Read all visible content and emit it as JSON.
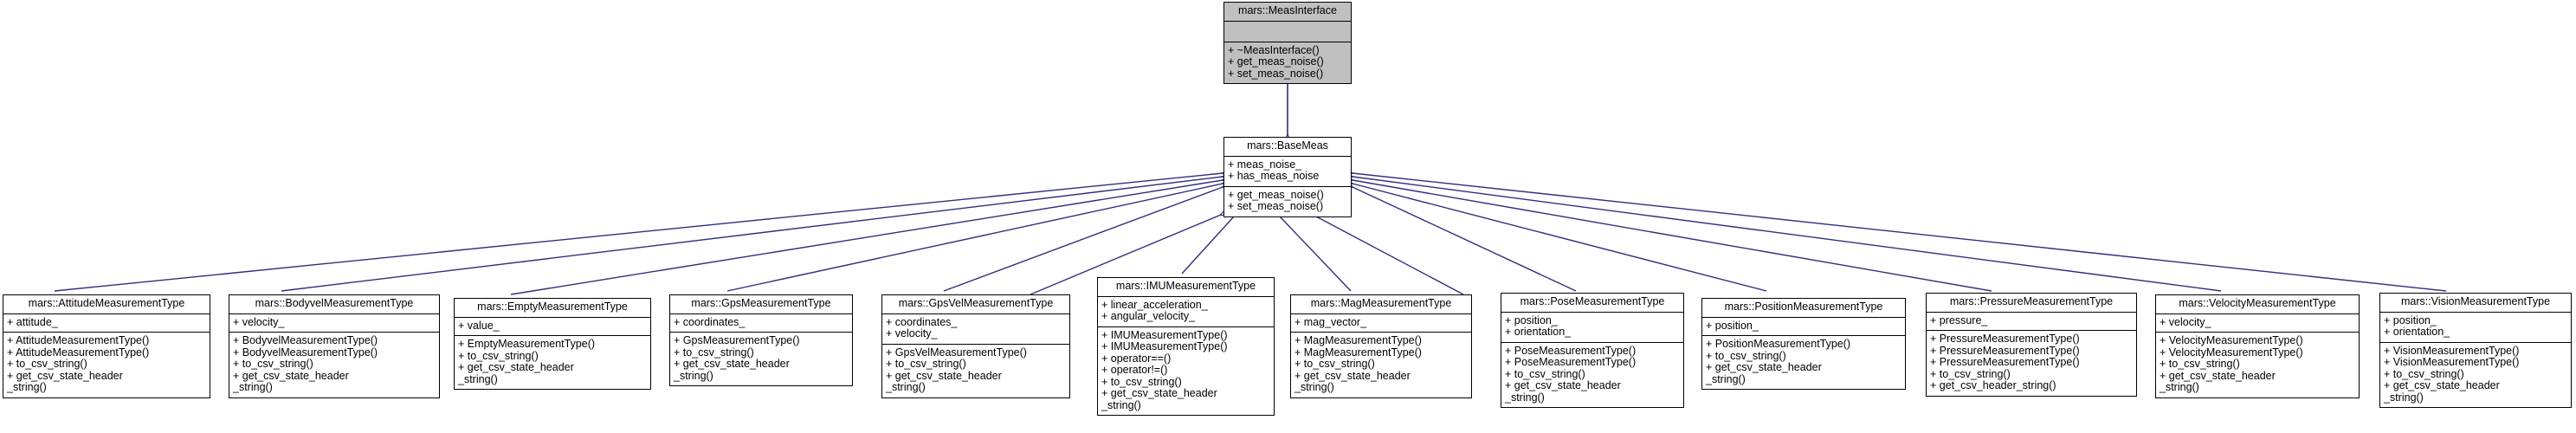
{
  "diagram": {
    "type": "uml-class-inheritance",
    "title": "mars::MeasInterface inheritance diagram",
    "namespace": "mars",
    "colors": {
      "interface_fill": "#c0c0c0",
      "class_fill": "#ffffff",
      "border": "#000000",
      "edge": "#2f2f7f",
      "text": "#000000"
    }
  },
  "classes": {
    "meas_interface": {
      "name": "mars::MeasInterface",
      "attributes": [],
      "operations": [
        "+ ~MeasInterface()",
        "+ get_meas_noise()",
        "+ set_meas_noise()"
      ]
    },
    "base_meas": {
      "name": "mars::BaseMeas",
      "attributes": [
        "+ meas_noise_",
        "+ has_meas_noise"
      ],
      "operations": [
        "+ get_meas_noise()",
        "+ set_meas_noise()"
      ]
    },
    "derived": [
      {
        "id": "attitude",
        "name": "mars::AttitudeMeasurementType",
        "attributes": [
          "+ attitude_"
        ],
        "operations": [
          "+ AttitudeMeasurementType()",
          "+ AttitudeMeasurementType()",
          "+ to_csv_string()",
          "+ get_csv_state_header",
          "_string()"
        ]
      },
      {
        "id": "bodyvel",
        "name": "mars::BodyvelMeasurementType",
        "attributes": [
          "+ velocity_"
        ],
        "operations": [
          "+ BodyvelMeasurementType()",
          "+ BodyvelMeasurementType()",
          "+ to_csv_string()",
          "+ get_csv_state_header",
          "_string()"
        ]
      },
      {
        "id": "empty",
        "name": "mars::EmptyMeasurementType",
        "attributes": [
          "+ value_"
        ],
        "operations": [
          "+ EmptyMeasurementType()",
          "+ to_csv_string()",
          "+ get_csv_state_header",
          "_string()"
        ]
      },
      {
        "id": "gps",
        "name": "mars::GpsMeasurementType",
        "attributes": [
          "+ coordinates_"
        ],
        "operations": [
          "+ GpsMeasurementType()",
          "+ to_csv_string()",
          "+ get_csv_state_header",
          "_string()"
        ]
      },
      {
        "id": "gpsvel",
        "name": "mars::GpsVelMeasurementType",
        "attributes": [
          "+ coordinates_",
          "+ velocity_"
        ],
        "operations": [
          "+ GpsVelMeasurementType()",
          "+ to_csv_string()",
          "+ get_csv_state_header",
          "_string()"
        ]
      },
      {
        "id": "imu",
        "name": "mars::IMUMeasurementType",
        "attributes": [
          "+ linear_acceleration_",
          "+ angular_velocity_"
        ],
        "operations": [
          "+ IMUMeasurementType()",
          "+ IMUMeasurementType()",
          "+ operator==()",
          "+ operator!=()",
          "+ to_csv_string()",
          "+ get_csv_state_header",
          "_string()"
        ]
      },
      {
        "id": "mag",
        "name": "mars::MagMeasurementType",
        "attributes": [
          "+ mag_vector_"
        ],
        "operations": [
          "+ MagMeasurementType()",
          "+ MagMeasurementType()",
          "+ to_csv_string()",
          "+ get_csv_state_header",
          "_string()"
        ]
      },
      {
        "id": "pose",
        "name": "mars::PoseMeasurementType",
        "attributes": [
          "+ position_",
          "+ orientation_"
        ],
        "operations": [
          "+ PoseMeasurementType()",
          "+ PoseMeasurementType()",
          "+ to_csv_string()",
          "+ get_csv_state_header",
          "_string()"
        ]
      },
      {
        "id": "position",
        "name": "mars::PositionMeasurementType",
        "attributes": [
          "+ position_"
        ],
        "operations": [
          "+ PositionMeasurementType()",
          "+ to_csv_string()",
          "+ get_csv_state_header",
          "_string()"
        ]
      },
      {
        "id": "pressure",
        "name": "mars::PressureMeasurementType",
        "attributes": [
          "+ pressure_"
        ],
        "operations": [
          "+ PressureMeasurementType()",
          "+ PressureMeasurementType()",
          "+ PressureMeasurementType()",
          "+ to_csv_string()",
          "+ get_csv_header_string()"
        ]
      },
      {
        "id": "velocity",
        "name": "mars::VelocityMeasurementType",
        "attributes": [
          "+ velocity_"
        ],
        "operations": [
          "+ VelocityMeasurementType()",
          "+ VelocityMeasurementType()",
          "+ to_csv_string()",
          "+ get_csv_state_header",
          "_string()"
        ]
      },
      {
        "id": "vision",
        "name": "mars::VisionMeasurementType",
        "attributes": [
          "+ position_",
          "+ orientation_"
        ],
        "operations": [
          "+ VisionMeasurementType()",
          "+ VisionMeasurementType()",
          "+ to_csv_string()",
          "+ get_csv_state_header",
          "_string()"
        ]
      }
    ]
  }
}
